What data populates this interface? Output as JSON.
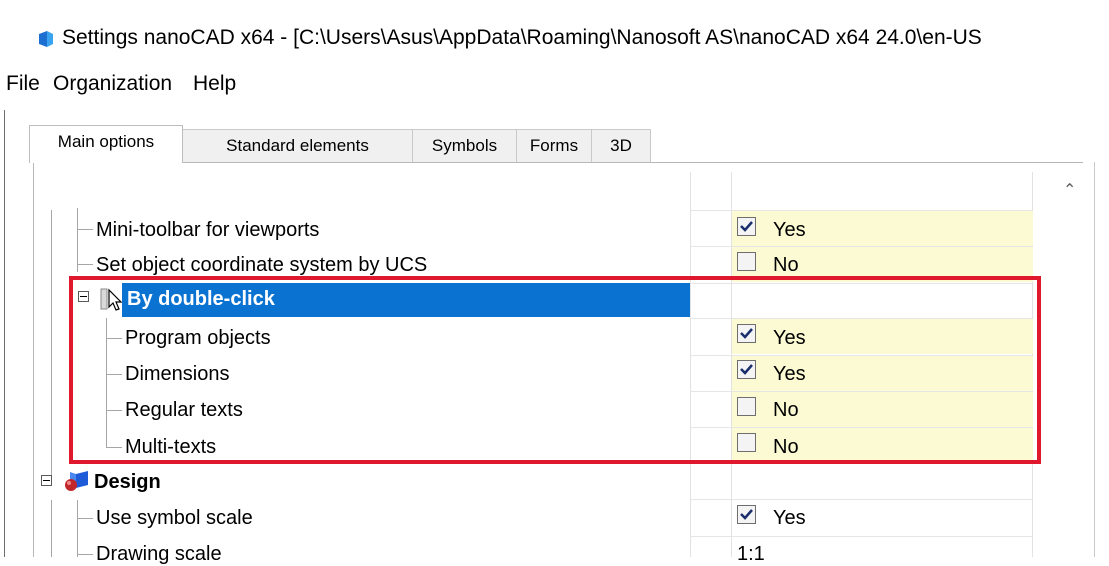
{
  "window": {
    "title": "Settings nanoCAD x64 - [C:\\Users\\Asus\\AppData\\Roaming\\Nanosoft AS\\nanoCAD x64 24.0\\en-US"
  },
  "menu": [
    "File",
    "Organization",
    "Help"
  ],
  "tabs": [
    {
      "label": "Main options",
      "active": true
    },
    {
      "label": "Standard elements",
      "active": false
    },
    {
      "label": "Symbols",
      "active": false
    },
    {
      "label": "Forms",
      "active": false
    },
    {
      "label": "3D",
      "active": false
    }
  ],
  "rows": [
    {
      "label": "Mini-toolbar for viewports",
      "value": "Yes",
      "checked": true
    },
    {
      "label": "Set object coordinate system by UCS",
      "value": "No",
      "checked": false
    },
    {
      "label": "By double-click",
      "group": true,
      "selected": true
    },
    {
      "label": "Program objects",
      "value": "Yes",
      "checked": true
    },
    {
      "label": "Dimensions",
      "value": "Yes",
      "checked": true
    },
    {
      "label": "Regular texts",
      "value": "No",
      "checked": false
    },
    {
      "label": "Multi-texts",
      "value": "No",
      "checked": false
    },
    {
      "label": "Design",
      "group": true,
      "icon": "design-icon"
    },
    {
      "label": "Use symbol scale",
      "value": "Yes",
      "checked": true
    },
    {
      "label": "Drawing scale",
      "value": "1:1"
    }
  ],
  "colors": {
    "selection": "#0a73d2",
    "value_background": "#fbfad2",
    "highlight_border": "#e0182d"
  },
  "icons": {
    "app": "nanocad-logo-icon",
    "scroll_up": "chevron-up-icon",
    "cursor": "mouse-pointer-icon"
  }
}
